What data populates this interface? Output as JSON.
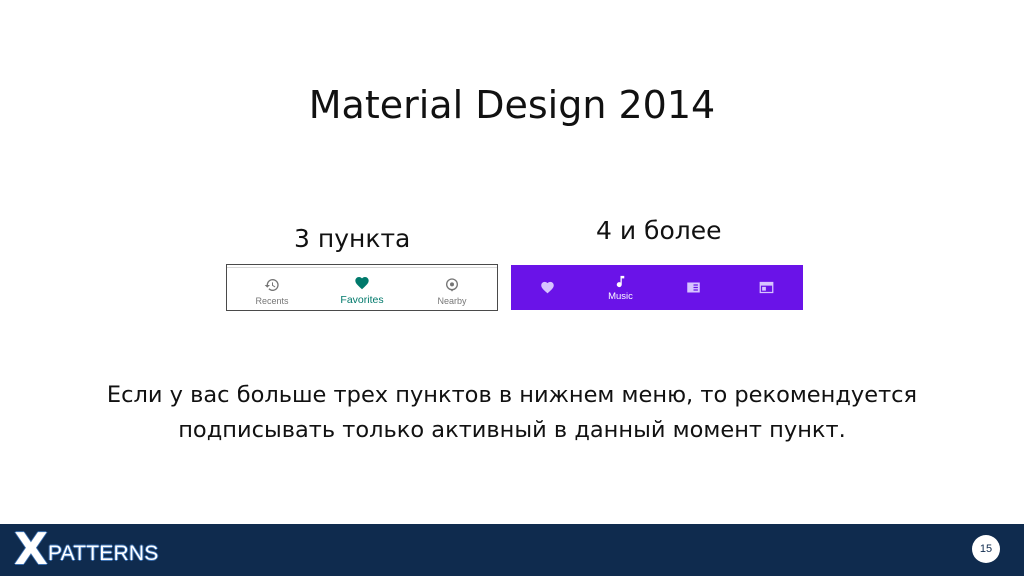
{
  "slide": {
    "title": "Material Design 2014",
    "label_three": "3 пункта",
    "label_four": "4 и более",
    "body_text": "Если у вас больше трех пунктов в нижнем меню, то рекомендуется подписывать только активный в данный момент пункт.",
    "page_number": "15"
  },
  "nav_three": {
    "background": "#ffffff",
    "active_color": "#00796b",
    "items": [
      {
        "label": "Recents",
        "icon": "history-icon"
      },
      {
        "label": "Favorites",
        "icon": "heart-icon",
        "active": true
      },
      {
        "label": "Nearby",
        "icon": "location-icon"
      }
    ]
  },
  "nav_four": {
    "background": "#6a13e8",
    "items": [
      {
        "label": "",
        "icon": "heart-icon"
      },
      {
        "label": "Music",
        "icon": "music-note-icon",
        "active": true
      },
      {
        "label": "",
        "icon": "book-icon"
      },
      {
        "label": "",
        "icon": "web-icon"
      }
    ]
  },
  "footer": {
    "logo_mark": "X",
    "logo_text": "PATTERNS",
    "background": "#0f2b4e"
  }
}
